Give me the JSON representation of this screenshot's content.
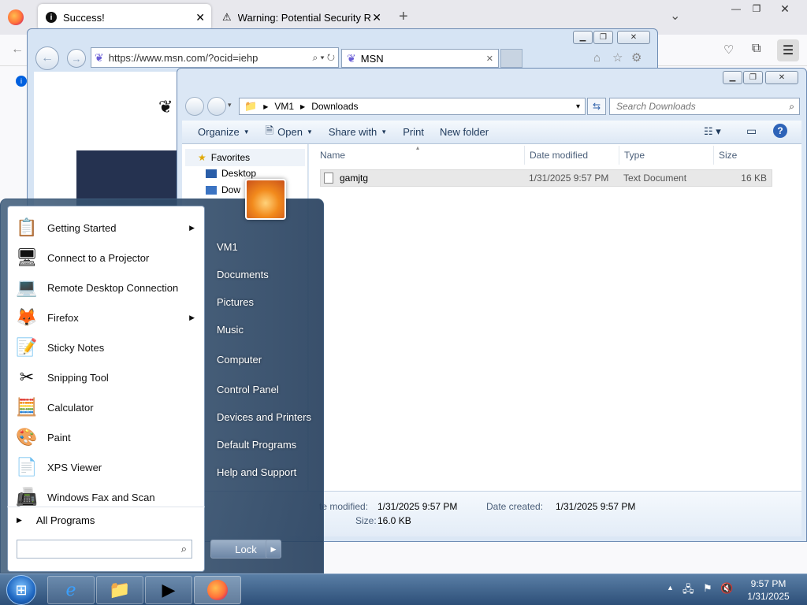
{
  "firefox": {
    "tabs": [
      {
        "title": "Success!"
      },
      {
        "title": "Warning: Potential Security Risk"
      }
    ],
    "new_tab": "+",
    "list_tabs": "⌄"
  },
  "ie": {
    "url": "https://www.msn.com/?ocid=iehp",
    "tab_title": "MSN"
  },
  "explorer": {
    "breadcrumb": [
      "VM1",
      "Downloads"
    ],
    "search_placeholder": "Search Downloads",
    "commands": [
      "Organize",
      "Open",
      "Share with",
      "Print",
      "New folder"
    ],
    "nav": {
      "favorites": "Favorites",
      "desktop": "Desktop",
      "downloads": "Dow"
    },
    "columns": [
      "Name",
      "Date modified",
      "Type",
      "Size"
    ],
    "files": [
      {
        "name": "gamjtg",
        "date": "1/31/2025 9:57 PM",
        "type": "Text Document",
        "size": "16 KB"
      }
    ],
    "details": {
      "modified_label": "te modified:",
      "modified_value": "1/31/2025 9:57 PM",
      "created_label": "Date created:",
      "created_value": "1/31/2025 9:57 PM",
      "size_label": "Size:",
      "size_value": "16.0 KB"
    }
  },
  "start_menu": {
    "programs": [
      {
        "label": "Getting Started",
        "icon": "getting-started-icon",
        "glyph": "📋",
        "submenu": true
      },
      {
        "label": "Connect to a Projector",
        "icon": "projector-icon",
        "glyph": "🖥",
        "submenu": false
      },
      {
        "label": "Remote Desktop Connection",
        "icon": "remote-desktop-icon",
        "glyph": "💻",
        "submenu": false
      },
      {
        "label": "Firefox",
        "icon": "firefox-icon",
        "glyph": "🦊",
        "submenu": true
      },
      {
        "label": "Sticky Notes",
        "icon": "sticky-notes-icon",
        "glyph": "📝",
        "submenu": false
      },
      {
        "label": "Snipping Tool",
        "icon": "scissors-icon",
        "glyph": "✂",
        "submenu": false
      },
      {
        "label": "Calculator",
        "icon": "calculator-icon",
        "glyph": "🧮",
        "submenu": false
      },
      {
        "label": "Paint",
        "icon": "paint-icon",
        "glyph": "🎨",
        "submenu": false
      },
      {
        "label": "XPS Viewer",
        "icon": "xps-viewer-icon",
        "glyph": "📄",
        "submenu": false
      },
      {
        "label": "Windows Fax and Scan",
        "icon": "fax-icon",
        "glyph": "📠",
        "submenu": false
      }
    ],
    "all_programs": "All Programs",
    "right_items": [
      "VM1",
      "Documents",
      "Pictures",
      "Music",
      "Computer",
      "Control Panel",
      "Devices and Printers",
      "Default Programs",
      "Help and Support"
    ],
    "lock": "Lock"
  },
  "taskbar": {
    "time": "9:57 PM",
    "date": "1/31/2025"
  }
}
